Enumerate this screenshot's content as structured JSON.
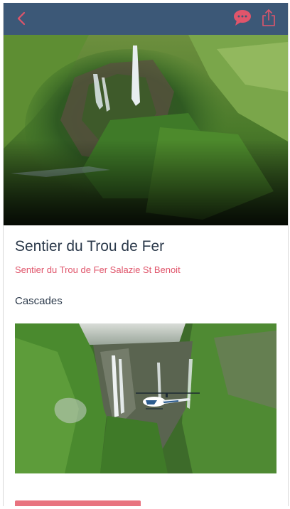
{
  "colors": {
    "navbar": "#3c5877",
    "accent": "#e0556b",
    "title_text": "#2c3a4b",
    "button": "#e8737f"
  },
  "navbar": {
    "back_icon": "chevron-left-icon",
    "chat_icon": "chat-bubble-icon",
    "share_icon": "share-icon"
  },
  "hero": {
    "image_icon": "waterfall-aerial-photo"
  },
  "place": {
    "title": "Sentier du Trou de Fer",
    "subtitle": "Sentier du Trou de Fer Salazie St Benoit",
    "category": "Cascades"
  },
  "gallery": {
    "image_icon": "waterfall-helicopter-photo"
  },
  "action": {
    "button_label": ""
  }
}
